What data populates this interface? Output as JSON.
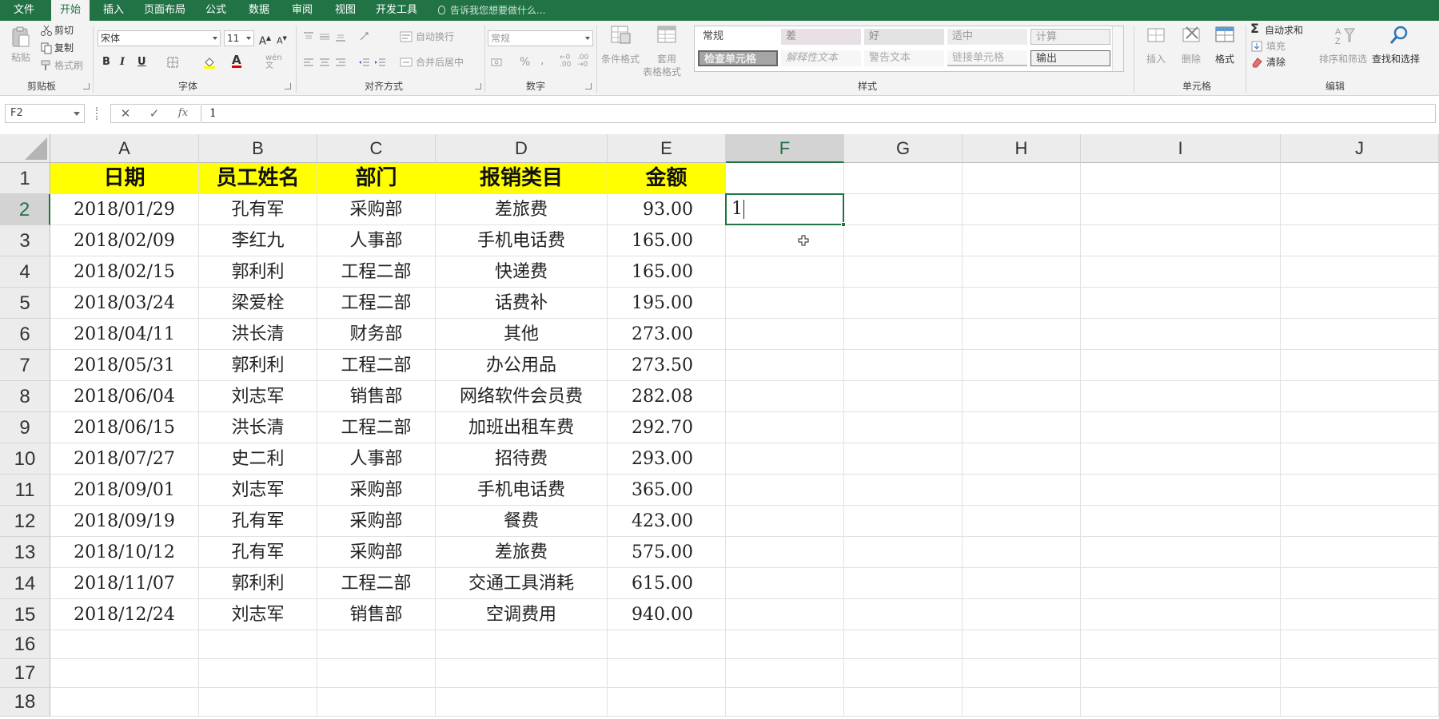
{
  "menu": {
    "tabs": [
      "文件",
      "开始",
      "插入",
      "页面布局",
      "公式",
      "数据",
      "审阅",
      "视图",
      "开发工具"
    ],
    "active_index": 1,
    "tell_me": "告诉我您想要做什么..."
  },
  "ribbon": {
    "clipboard": {
      "label": "剪贴板",
      "paste": "粘贴",
      "cut": "剪切",
      "copy": "复制",
      "format_painter": "格式刷"
    },
    "font": {
      "label": "字体",
      "font_name": "宋体",
      "font_size": "11",
      "bold": "B",
      "italic": "I",
      "underline": "U"
    },
    "alignment": {
      "label": "对齐方式",
      "wrap_text": "自动换行",
      "merge_center": "合并后居中"
    },
    "number": {
      "label": "数字",
      "format": "常规",
      "percent": "%",
      "comma": ","
    },
    "styles": {
      "label": "样式",
      "conditional_format": "条件格式",
      "table_format_1": "套用",
      "table_format_2": "表格格式",
      "cells": [
        "常规",
        "差",
        "好",
        "适中",
        "计算",
        "检查单元格",
        "解释性文本",
        "警告文本",
        "链接单元格",
        "输出"
      ]
    },
    "cells": {
      "label": "单元格",
      "insert": "插入",
      "delete": "删除",
      "format": "格式"
    },
    "editing": {
      "label": "编辑",
      "autosum": "自动求和",
      "fill": "填充",
      "clear": "清除",
      "sort_filter": "排序和筛选",
      "find_select": "查找和选择"
    }
  },
  "formula_bar": {
    "name_box": "F2",
    "cancel": "✕",
    "enter": "✓",
    "fx": "fx",
    "value": "1"
  },
  "sheet": {
    "columns": [
      "A",
      "B",
      "C",
      "D",
      "E",
      "F",
      "G",
      "H",
      "I",
      "J"
    ],
    "selected_column": "F",
    "selected_row": "2",
    "row_numbers": [
      "1",
      "2",
      "3",
      "4",
      "5",
      "6",
      "7",
      "8",
      "9",
      "10",
      "11",
      "12",
      "13",
      "14",
      "15",
      "16",
      "17",
      "18"
    ],
    "headers": [
      "日期",
      "员工姓名",
      "部门",
      "报销类目",
      "金额"
    ],
    "rows": [
      [
        "2018/01/29",
        "孔有军",
        "采购部",
        "差旅费",
        "93.00"
      ],
      [
        "2018/02/09",
        "李红九",
        "人事部",
        "手机电话费",
        "165.00"
      ],
      [
        "2018/02/15",
        "郭利利",
        "工程二部",
        "快递费",
        "165.00"
      ],
      [
        "2018/03/24",
        "梁爱栓",
        "工程二部",
        "话费补",
        "195.00"
      ],
      [
        "2018/04/11",
        "洪长清",
        "财务部",
        "其他",
        "273.00"
      ],
      [
        "2018/05/31",
        "郭利利",
        "工程二部",
        "办公用品",
        "273.50"
      ],
      [
        "2018/06/04",
        "刘志军",
        "销售部",
        "网络软件会员费",
        "282.08"
      ],
      [
        "2018/06/15",
        "洪长清",
        "工程二部",
        "加班出租车费",
        "292.70"
      ],
      [
        "2018/07/27",
        "史二利",
        "人事部",
        "招待费",
        "293.00"
      ],
      [
        "2018/09/01",
        "刘志军",
        "采购部",
        "手机电话费",
        "365.00"
      ],
      [
        "2018/09/19",
        "孔有军",
        "采购部",
        "餐费",
        "423.00"
      ],
      [
        "2018/10/12",
        "孔有军",
        "采购部",
        "差旅费",
        "575.00"
      ],
      [
        "2018/11/07",
        "郭利利",
        "工程二部",
        "交通工具消耗",
        "615.00"
      ],
      [
        "2018/12/24",
        "刘志军",
        "销售部",
        "空调费用",
        "940.00"
      ]
    ],
    "active_cell_value": "1"
  }
}
